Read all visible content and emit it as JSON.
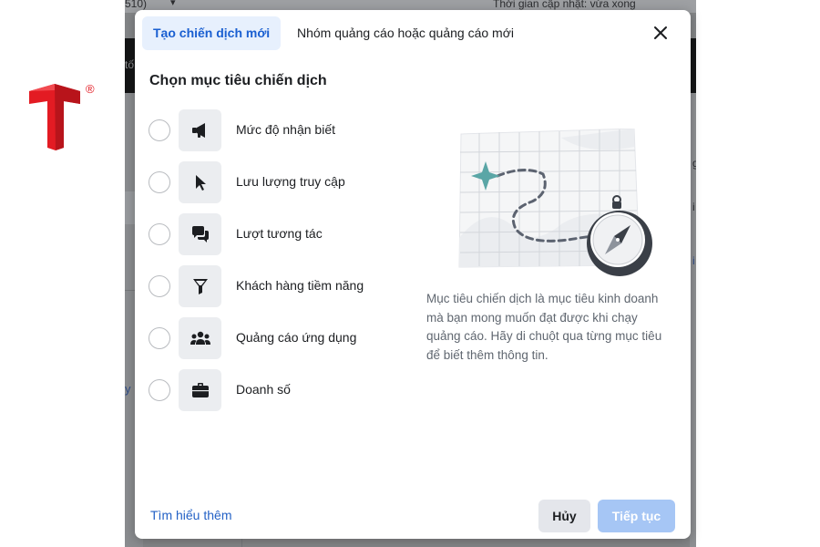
{
  "background": {
    "top_left_text": "510)",
    "top_right_text": "Thời gian cập nhật: vừa xong",
    "dark_bar_text": "tố",
    "left_link_fragment": "y",
    "right_fragments": [
      "g",
      "i",
      "i"
    ]
  },
  "brand": {
    "registered_mark": "®",
    "logo_color": "#e31b23"
  },
  "modal": {
    "tabs": [
      {
        "label": "Tạo chiến dịch mới",
        "active": true
      },
      {
        "label": "Nhóm quảng cáo hoặc quảng cáo mới",
        "active": false
      }
    ],
    "close_icon": "close-icon",
    "heading": "Chọn mục tiêu chiến dịch",
    "objectives": [
      {
        "label": "Mức độ nhận biết",
        "icon": "megaphone-icon",
        "selected": false
      },
      {
        "label": "Lưu lượng truy cập",
        "icon": "cursor-icon",
        "selected": false
      },
      {
        "label": "Lượt tương tác",
        "icon": "chat-bubbles-icon",
        "selected": false
      },
      {
        "label": "Khách hàng tiềm năng",
        "icon": "funnel-icon",
        "selected": false
      },
      {
        "label": "Quảng cáo ứng dụng",
        "icon": "people-icon",
        "selected": false
      },
      {
        "label": "Doanh số",
        "icon": "briefcase-icon",
        "selected": false
      }
    ],
    "description": "Mục tiêu chiến dịch là mục tiêu kinh doanh mà bạn mong muốn đạt được khi chạy quảng cáo. Hãy di chuột qua từng mục tiêu để biết thêm thông tin.",
    "footer": {
      "learn_more": "Tìm hiểu thêm",
      "cancel": "Hủy",
      "continue": "Tiếp tục"
    }
  },
  "colors": {
    "accent": "#1a5fd1",
    "link": "#2462c6",
    "continue_disabled": "#a6c6f5",
    "map_star": "#5aa6a6"
  }
}
